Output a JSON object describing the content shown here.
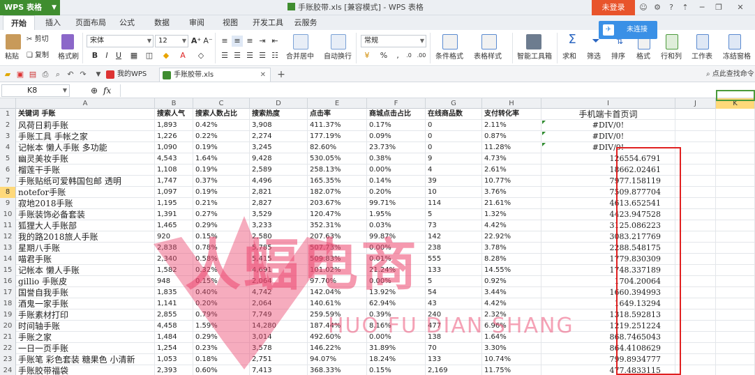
{
  "titlebar": {
    "app_name": "WPS 表格",
    "doc_title": "手账胶带.xls [兼容模式] - WPS 表格",
    "login": "未登录"
  },
  "menu": [
    "开始",
    "插入",
    "页面布局",
    "公式",
    "数据",
    "审阅",
    "视图",
    "开发工具",
    "云服务"
  ],
  "ribbon": {
    "paste": "粘贴",
    "cut": "剪切",
    "copy": "复制",
    "format_painter": "格式刷",
    "font_name": "宋体",
    "font_size": "12",
    "bold": "B",
    "italic": "I",
    "underline": "U",
    "number_format": "常规",
    "merge_center": "合并居中",
    "wrap_text": "自动换行",
    "conditional_format": "条件格式",
    "table_style": "表格样式",
    "smart_toolbox": "智能工具箱",
    "sum": "求和",
    "filter": "筛选",
    "sort": "排序",
    "format": "格式",
    "row_col": "行和列",
    "worksheet": "工作表",
    "freeze": "冻结窗格",
    "percent": "%",
    "unconnected": "未连接"
  },
  "doctabs": {
    "my_wps": "我的WPS",
    "file": "手账胶带.xls",
    "add": "+",
    "search": "点此查找命令"
  },
  "formula": {
    "cell_ref": "K8",
    "fx": "fx",
    "value": ""
  },
  "columns": [
    "A",
    "B",
    "C",
    "D",
    "E",
    "F",
    "G",
    "H",
    "I",
    "J",
    "K"
  ],
  "selected_column": "K",
  "selected_row": "8",
  "header_row": [
    "关键词 手账",
    "搜索人气",
    "搜索人数占比",
    "搜索热度",
    "点击率",
    "商城点击占比",
    "在线商品数",
    "支付转化率",
    "手机端卡首页词"
  ],
  "rows": [
    [
      "风荷日莉手账",
      "1,893",
      "0.42%",
      "3,908",
      "411.37%",
      "0.17%",
      "0",
      "2.11%",
      "#DIV/0!"
    ],
    [
      "手账工具 手帐之家",
      "1,226",
      "0.22%",
      "2,274",
      "177.19%",
      "0.09%",
      "0",
      "0.87%",
      "#DIV/0!"
    ],
    [
      "记帐本 懒人手账 多功能",
      "1,090",
      "0.19%",
      "3,245",
      "82.60%",
      "23.73%",
      "0",
      "11.28%",
      "#DIV/0!"
    ],
    [
      "幽灵美妆手账",
      "4,543",
      "1.64%",
      "9,428",
      "530.05%",
      "0.38%",
      "9",
      "4.73%",
      "126554.6791"
    ],
    [
      "榴莲干手账",
      "1,108",
      "0.19%",
      "2,589",
      "258.13%",
      "0.00%",
      "4",
      "2.61%",
      "18662.02461"
    ],
    [
      "手账贴纸可爱韩国包邮 透明",
      "1,747",
      "0.37%",
      "4,496",
      "165.35%",
      "0.14%",
      "39",
      "10.77%",
      "7977.158119"
    ],
    [
      "notefor手账",
      "1,097",
      "0.19%",
      "2,821",
      "182.07%",
      "0.20%",
      "10",
      "3.76%",
      "7509.877704"
    ],
    [
      "寂地2018手账",
      "1,195",
      "0.21%",
      "2,827",
      "203.67%",
      "99.71%",
      "114",
      "21.61%",
      "4613.652541"
    ],
    [
      "手账装饰必备套装",
      "1,391",
      "0.27%",
      "3,529",
      "120.47%",
      "1.95%",
      "5",
      "1.32%",
      "4423.947528"
    ],
    [
      "狐狸大人手账部",
      "1,465",
      "0.29%",
      "3,233",
      "352.31%",
      "0.03%",
      "73",
      "4.42%",
      "3125.086223"
    ],
    [
      "我的路2018旅人手账",
      "920",
      "0.15%",
      "2,580",
      "207.63%",
      "99.87%",
      "142",
      "22.92%",
      "3083.217769"
    ],
    [
      "星期八手账",
      "2,838",
      "0.78%",
      "5,785",
      "507.73%",
      "0.00%",
      "238",
      "3.78%",
      "2288.548175"
    ],
    [
      "喵君手账",
      "2,340",
      "0.58%",
      "5,415",
      "509.83%",
      "0.01%",
      "555",
      "8.28%",
      "1779.830309"
    ],
    [
      "记帐本 懒人手账",
      "1,582",
      "0.32%",
      "4,691",
      "101.02%",
      "21.24%",
      "133",
      "14.55%",
      "1748.337189"
    ],
    [
      "gillio 手账皮",
      "948",
      "0.15%",
      "2,064",
      "97.70%",
      "0.00%",
      "5",
      "0.92%",
      "1704.20064"
    ],
    [
      "国誉自我手账",
      "1,835",
      "0.40%",
      "4,742",
      "142.04%",
      "13.92%",
      "54",
      "3.44%",
      "1660.394993"
    ],
    [
      "酒鬼一家手账",
      "1,141",
      "0.20%",
      "2,064",
      "140.61%",
      "62.94%",
      "43",
      "4.42%",
      "1649.13294"
    ],
    [
      "手账素材打印",
      "2,855",
      "0.79%",
      "7,749",
      "259.59%",
      "0.39%",
      "240",
      "2.32%",
      "1318.592813"
    ],
    [
      "时间轴手账",
      "4,458",
      "1.59%",
      "14,280",
      "187.44%",
      "8.16%",
      "477",
      "6.96%",
      "1219.251224"
    ],
    [
      "手账之家",
      "1,484",
      "0.29%",
      "3,014",
      "492.60%",
      "0.00%",
      "138",
      "1.64%",
      "868.7465043"
    ],
    [
      "一日一页手账",
      "1,254",
      "0.23%",
      "3,578",
      "146.22%",
      "31.89%",
      "70",
      "3.30%",
      "864.4108629"
    ],
    [
      "手账笔 彩色套装 糖果色 小清新",
      "1,053",
      "0.18%",
      "2,751",
      "94.07%",
      "18.24%",
      "133",
      "10.74%",
      "799.8934777"
    ],
    [
      "手账胶带福袋",
      "2,393",
      "0.60%",
      "7,413",
      "368.33%",
      "0.15%",
      "2,169",
      "11.75%",
      "477.4833115"
    ]
  ],
  "watermark": {
    "cn": "人蝠电商",
    "en": "HUO FU DIAN SHANG"
  }
}
